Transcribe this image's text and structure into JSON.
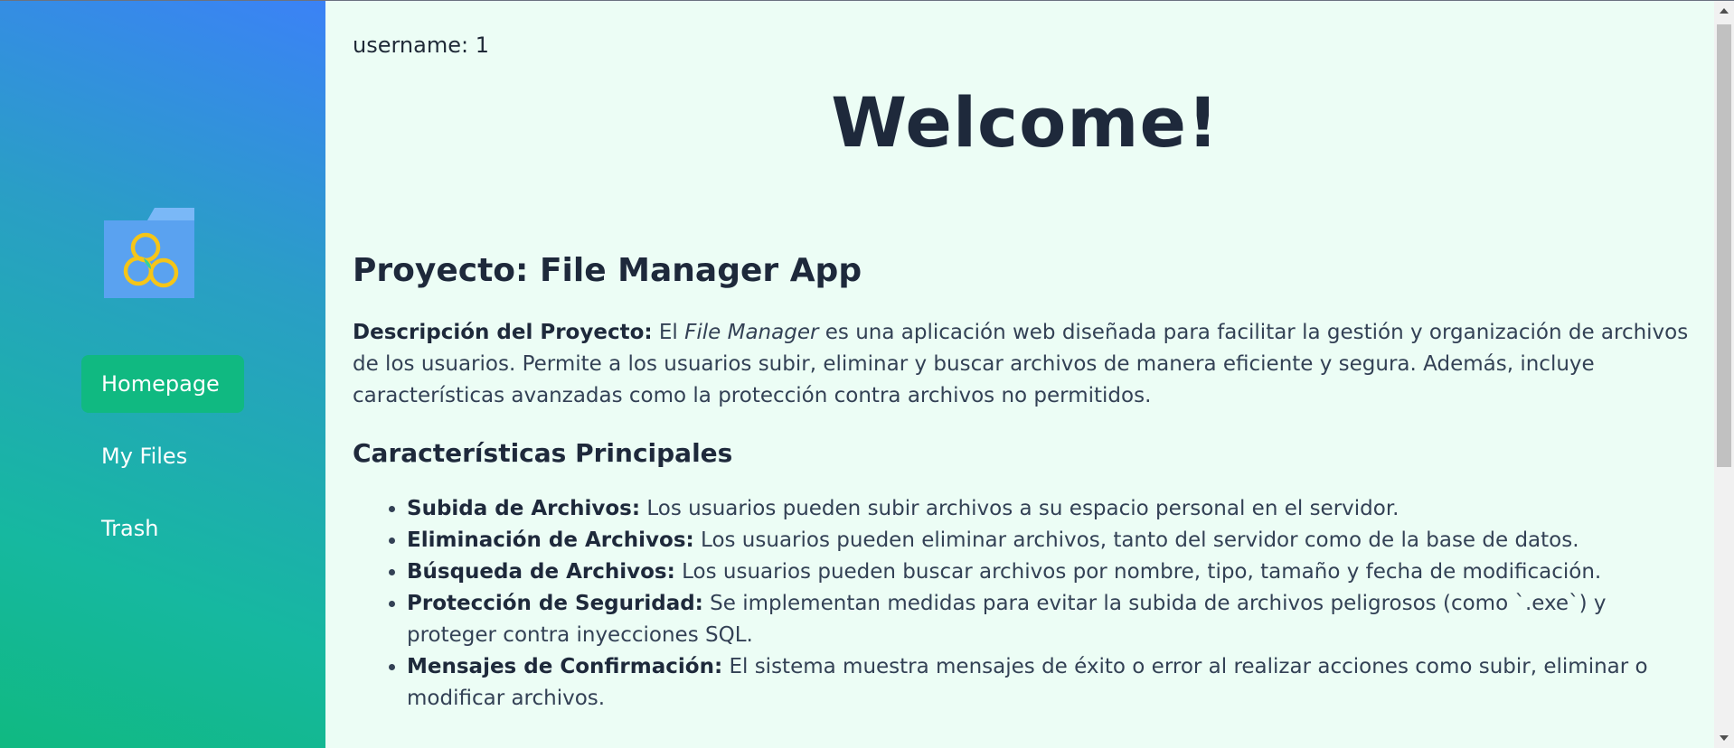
{
  "sidebar": {
    "logo_icon": "folder-clover-logo-icon",
    "items": [
      {
        "label": "Homepage",
        "active": true
      },
      {
        "label": "My Files",
        "active": false
      },
      {
        "label": "Trash",
        "active": false
      }
    ]
  },
  "main": {
    "username": "username: 1",
    "welcome": "Welcome!",
    "project_title": "Proyecto: File Manager App",
    "description": {
      "label": "Descripción del Proyecto:",
      "pre": " El ",
      "emphasis": "File Manager",
      "post": " es una aplicación web diseñada para facilitar la gestión y organización de archivos de los usuarios. Permite a los usuarios subir, eliminar y buscar archivos de manera eficiente y segura. Además, incluye características avanzadas como la protección contra archivos no permitidos."
    },
    "features_title": "Características Principales",
    "features": [
      {
        "label": "Subida de Archivos:",
        "text": " Los usuarios pueden subir archivos a su espacio personal en el servidor."
      },
      {
        "label": "Eliminación de Archivos:",
        "text": " Los usuarios pueden eliminar archivos, tanto del servidor como de la base de datos."
      },
      {
        "label": "Búsqueda de Archivos:",
        "text": " Los usuarios pueden buscar archivos por nombre, tipo, tamaño y fecha de modificación."
      },
      {
        "label": "Protección de Seguridad:",
        "text": " Se implementan medidas para evitar la subida de archivos peligrosos (como `.exe`) y proteger contra inyecciones SQL."
      },
      {
        "label": "Mensajes de Confirmación:",
        "text": " El sistema muestra mensajes de éxito o error al realizar acciones como subir, eliminar o modificar archivos."
      }
    ]
  },
  "colors": {
    "sidebar_top": "#3b82f6",
    "sidebar_bottom": "#10b981",
    "active_item": "#10b981",
    "main_bg": "#ecfdf5",
    "heading": "#1e293b"
  }
}
